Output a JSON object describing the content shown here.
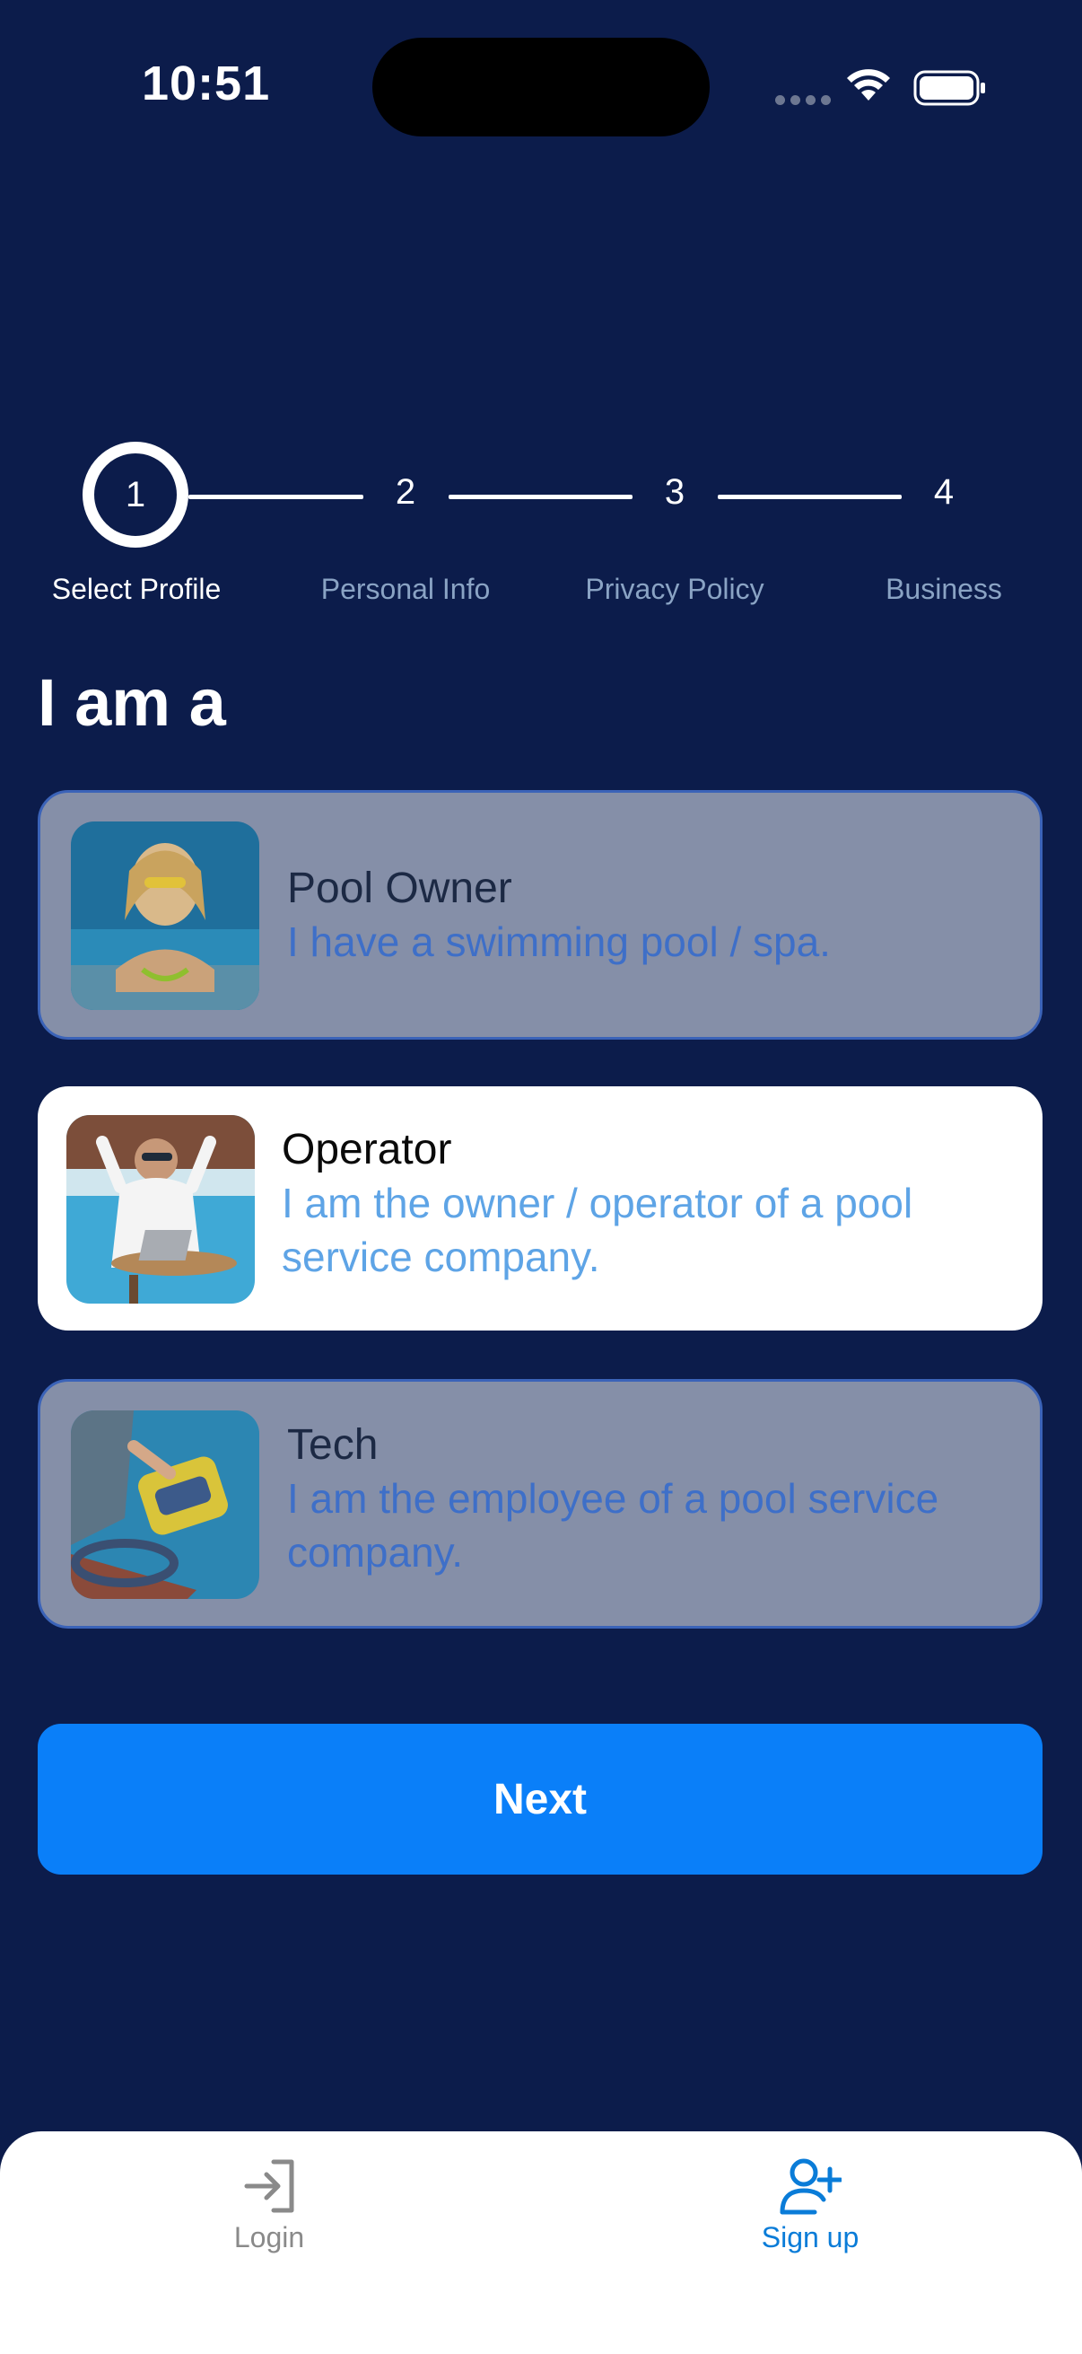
{
  "status": {
    "time": "10:51"
  },
  "stepper": {
    "steps": [
      {
        "number": "1",
        "label": "Select Profile"
      },
      {
        "number": "2",
        "label": "Personal Info"
      },
      {
        "number": "3",
        "label": "Privacy Policy"
      },
      {
        "number": "4",
        "label": "Business"
      }
    ],
    "current": 1
  },
  "page": {
    "title": "I am a"
  },
  "options": [
    {
      "title": "Pool Owner",
      "description": "I have a swimming pool / spa.",
      "selected": false
    },
    {
      "title": "Operator",
      "description": "I am the owner / operator of a pool service company.",
      "selected": true
    },
    {
      "title": "Tech",
      "description": "I am the employee of a pool service company.",
      "selected": false
    }
  ],
  "actions": {
    "next_label": "Next"
  },
  "tabbar": {
    "items": [
      {
        "label": "Login",
        "icon": "login-icon",
        "active": false
      },
      {
        "label": "Sign up",
        "icon": "add-user-icon",
        "active": true
      }
    ]
  },
  "colors": {
    "background": "#0c1c4b",
    "primary": "#0a7ff9",
    "card_dim": "#858fa8",
    "tab_active": "#0a7cd8",
    "tab_inactive": "#8a8a8a"
  }
}
